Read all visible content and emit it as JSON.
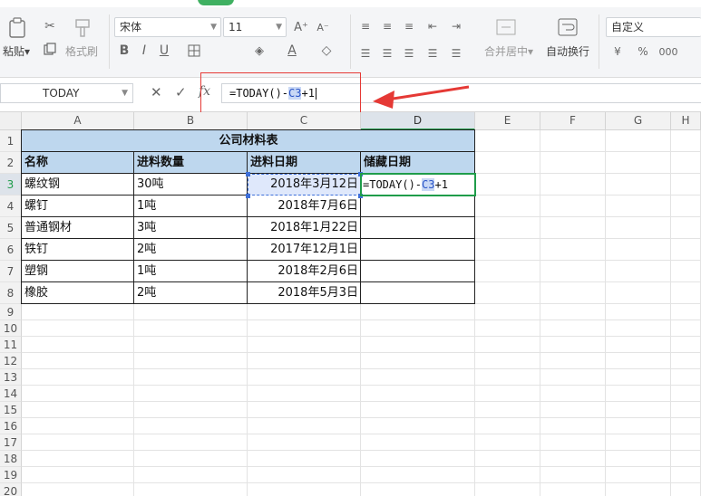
{
  "ribbon": {
    "paste_label": "粘贴",
    "format_painter_label": "格式刷",
    "font_name": "宋体",
    "font_size": "11",
    "merge_center_label": "合并居中",
    "wrap_text_label": "自动换行",
    "number_format": "自定义"
  },
  "formula_bar": {
    "name_box": "TODAY",
    "fx_label": "fx",
    "formula_prefix": "=TODAY()-",
    "formula_ref": "C3",
    "formula_suffix": "+1"
  },
  "columns": [
    "A",
    "B",
    "C",
    "D",
    "E",
    "F",
    "G",
    "H"
  ],
  "rows": [
    "1",
    "2",
    "3",
    "4",
    "5",
    "6",
    "7",
    "8",
    "9",
    "10",
    "11",
    "12",
    "13",
    "14",
    "15",
    "16",
    "17",
    "18",
    "19",
    "20"
  ],
  "sheet": {
    "title": "公司材料表",
    "headers": [
      "名称",
      "进料数量",
      "进料日期",
      "储藏日期"
    ],
    "data": [
      {
        "name": "螺纹钢",
        "qty": "30吨",
        "date": "2018年3月12日",
        "storage": "=TODAY()-C3+1"
      },
      {
        "name": "螺钉",
        "qty": "1吨",
        "date": "2018年7月6日",
        "storage": ""
      },
      {
        "name": "普通钢材",
        "qty": "3吨",
        "date": "2018年1月22日",
        "storage": ""
      },
      {
        "name": "铁钉",
        "qty": "2吨",
        "date": "2017年12月1日",
        "storage": ""
      },
      {
        "name": "塑钢",
        "qty": "1吨",
        "date": "2018年2月6日",
        "storage": ""
      },
      {
        "name": "橡胶",
        "qty": "2吨",
        "date": "2018年5月3日",
        "storage": ""
      }
    ],
    "editing_cell": {
      "prefix": "=TODAY()-",
      "ref": "C3",
      "suffix": "+1"
    }
  },
  "colors": {
    "accent_green": "#1f9c4a",
    "header_fill": "#bed7ee",
    "annotation_red": "#e53935",
    "ref_blue": "#3d6fd9"
  }
}
